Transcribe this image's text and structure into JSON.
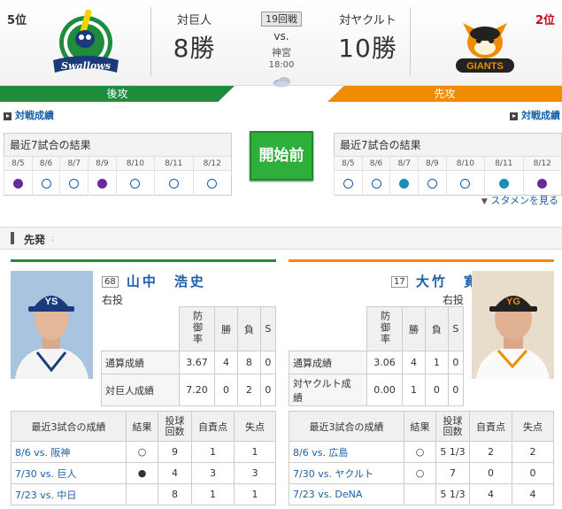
{
  "header": {
    "left": {
      "rank": "5位",
      "vs_label": "対巨人",
      "wins": "8勝",
      "batting": "後攻"
    },
    "right": {
      "rank": "2位",
      "vs_label": "対ヤクルト",
      "wins": "10勝",
      "batting": "先攻"
    },
    "game_no": "19回戦",
    "vs": "vs.",
    "stadium": "神宮",
    "time": "18:00",
    "weather_icon": "cloud-icon",
    "colors": {
      "swallows_green": "#1e8c3c",
      "giants_orange": "#f08c00"
    }
  },
  "links": {
    "team_stats_left": "対戦成績",
    "team_stats_right": "対戦成績",
    "lineup": "スタメンを見る"
  },
  "recent": {
    "title": "最近7試合の結果",
    "left_dates": [
      "8/5",
      "8/6",
      "8/7",
      "8/9",
      "8/10",
      "8/11",
      "8/12"
    ],
    "left_results": [
      "purple",
      "empty",
      "empty",
      "purple",
      "empty",
      "empty",
      "empty"
    ],
    "right_dates": [
      "8/5",
      "8/6",
      "8/7",
      "8/9",
      "8/10",
      "8/11",
      "8/12"
    ],
    "right_results": [
      "empty",
      "empty",
      "teal",
      "empty",
      "empty",
      "teal",
      "purple"
    ],
    "start_label": "開始前"
  },
  "starters": {
    "section": "先発",
    "left": {
      "number": "68",
      "name": "山中　浩史",
      "throws": "右投",
      "stat_headers": [
        "防御率",
        "勝",
        "負",
        "S"
      ],
      "rows": [
        {
          "label": "通算成績",
          "vals": [
            "3.67",
            "4",
            "8",
            "0"
          ]
        },
        {
          "label": "対巨人成績",
          "vals": [
            "7.20",
            "0",
            "2",
            "0"
          ]
        }
      ],
      "recent_headers": [
        "最近3試合の成績",
        "結果",
        "投球回数",
        "自責点",
        "失点"
      ],
      "recent": [
        {
          "game": "8/6 vs. 阪神",
          "result": "○",
          "ip": "9",
          "er": "1",
          "r": "1"
        },
        {
          "game": "7/30 vs. 巨人",
          "result": "●",
          "ip": "4",
          "er": "3",
          "r": "3"
        },
        {
          "game": "7/23 vs. 中日",
          "result": "",
          "ip": "8",
          "er": "1",
          "r": "1"
        }
      ]
    },
    "right": {
      "number": "17",
      "name": "大竹　寛",
      "throws": "右投",
      "stat_headers": [
        "防御率",
        "勝",
        "負",
        "S"
      ],
      "rows": [
        {
          "label": "通算成績",
          "vals": [
            "3.06",
            "4",
            "1",
            "0"
          ]
        },
        {
          "label": "対ヤクルト成績",
          "vals": [
            "0.00",
            "1",
            "0",
            "0"
          ]
        }
      ],
      "recent_headers": [
        "最近3試合の成績",
        "結果",
        "投球回数",
        "自責点",
        "失点"
      ],
      "recent": [
        {
          "game": "8/6 vs. 広島",
          "result": "○",
          "ip": "5 1/3",
          "er": "2",
          "r": "2"
        },
        {
          "game": "7/30 vs. ヤクルト",
          "result": "○",
          "ip": "7",
          "er": "0",
          "r": "0"
        },
        {
          "game": "7/23 vs. DeNA",
          "result": "",
          "ip": "5 1/3",
          "er": "4",
          "r": "4"
        }
      ]
    }
  }
}
